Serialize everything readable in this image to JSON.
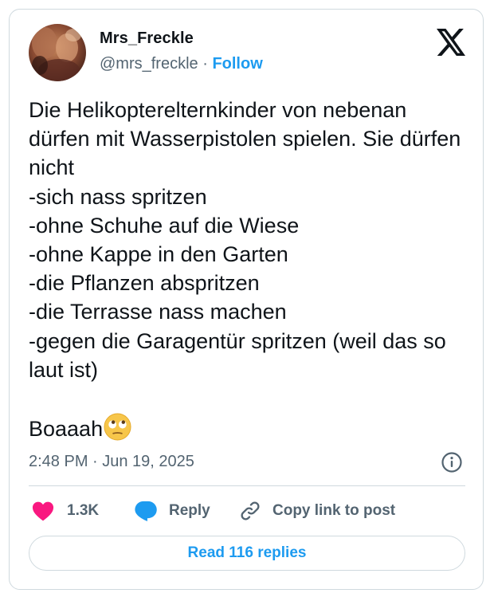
{
  "author": {
    "display_name": "Mrs_Freckle",
    "handle": "@mrs_freckle",
    "separator": " · ",
    "follow_label": "Follow",
    "avatar_icon": "avatar-photo"
  },
  "tweet": {
    "text": "Die Helikopterelternkinder von nebenan dürfen mit Wasserpistolen spielen. Sie dürfen nicht\n-sich nass spritzen\n-ohne Schuhe auf die Wiese\n-ohne Kappe in den Garten\n-die Pflanzen abspritzen\n-die Terrasse nass machen\n-gegen die Garagentür spritzen (weil das so laut ist)\n\nBoaaah",
    "emoji_icon": "face-with-rolling-eyes",
    "timestamp": "2:48 PM · Jun 19, 2025"
  },
  "actions": {
    "like_count": "1.3K",
    "reply_label": "Reply",
    "copy_link_label": "Copy link to post"
  },
  "read_replies_label": "Read 116 replies",
  "colors": {
    "accent": "#1d9bf0",
    "like": "#f91880",
    "secondary_text": "#536471",
    "border": "#cfd9de"
  }
}
